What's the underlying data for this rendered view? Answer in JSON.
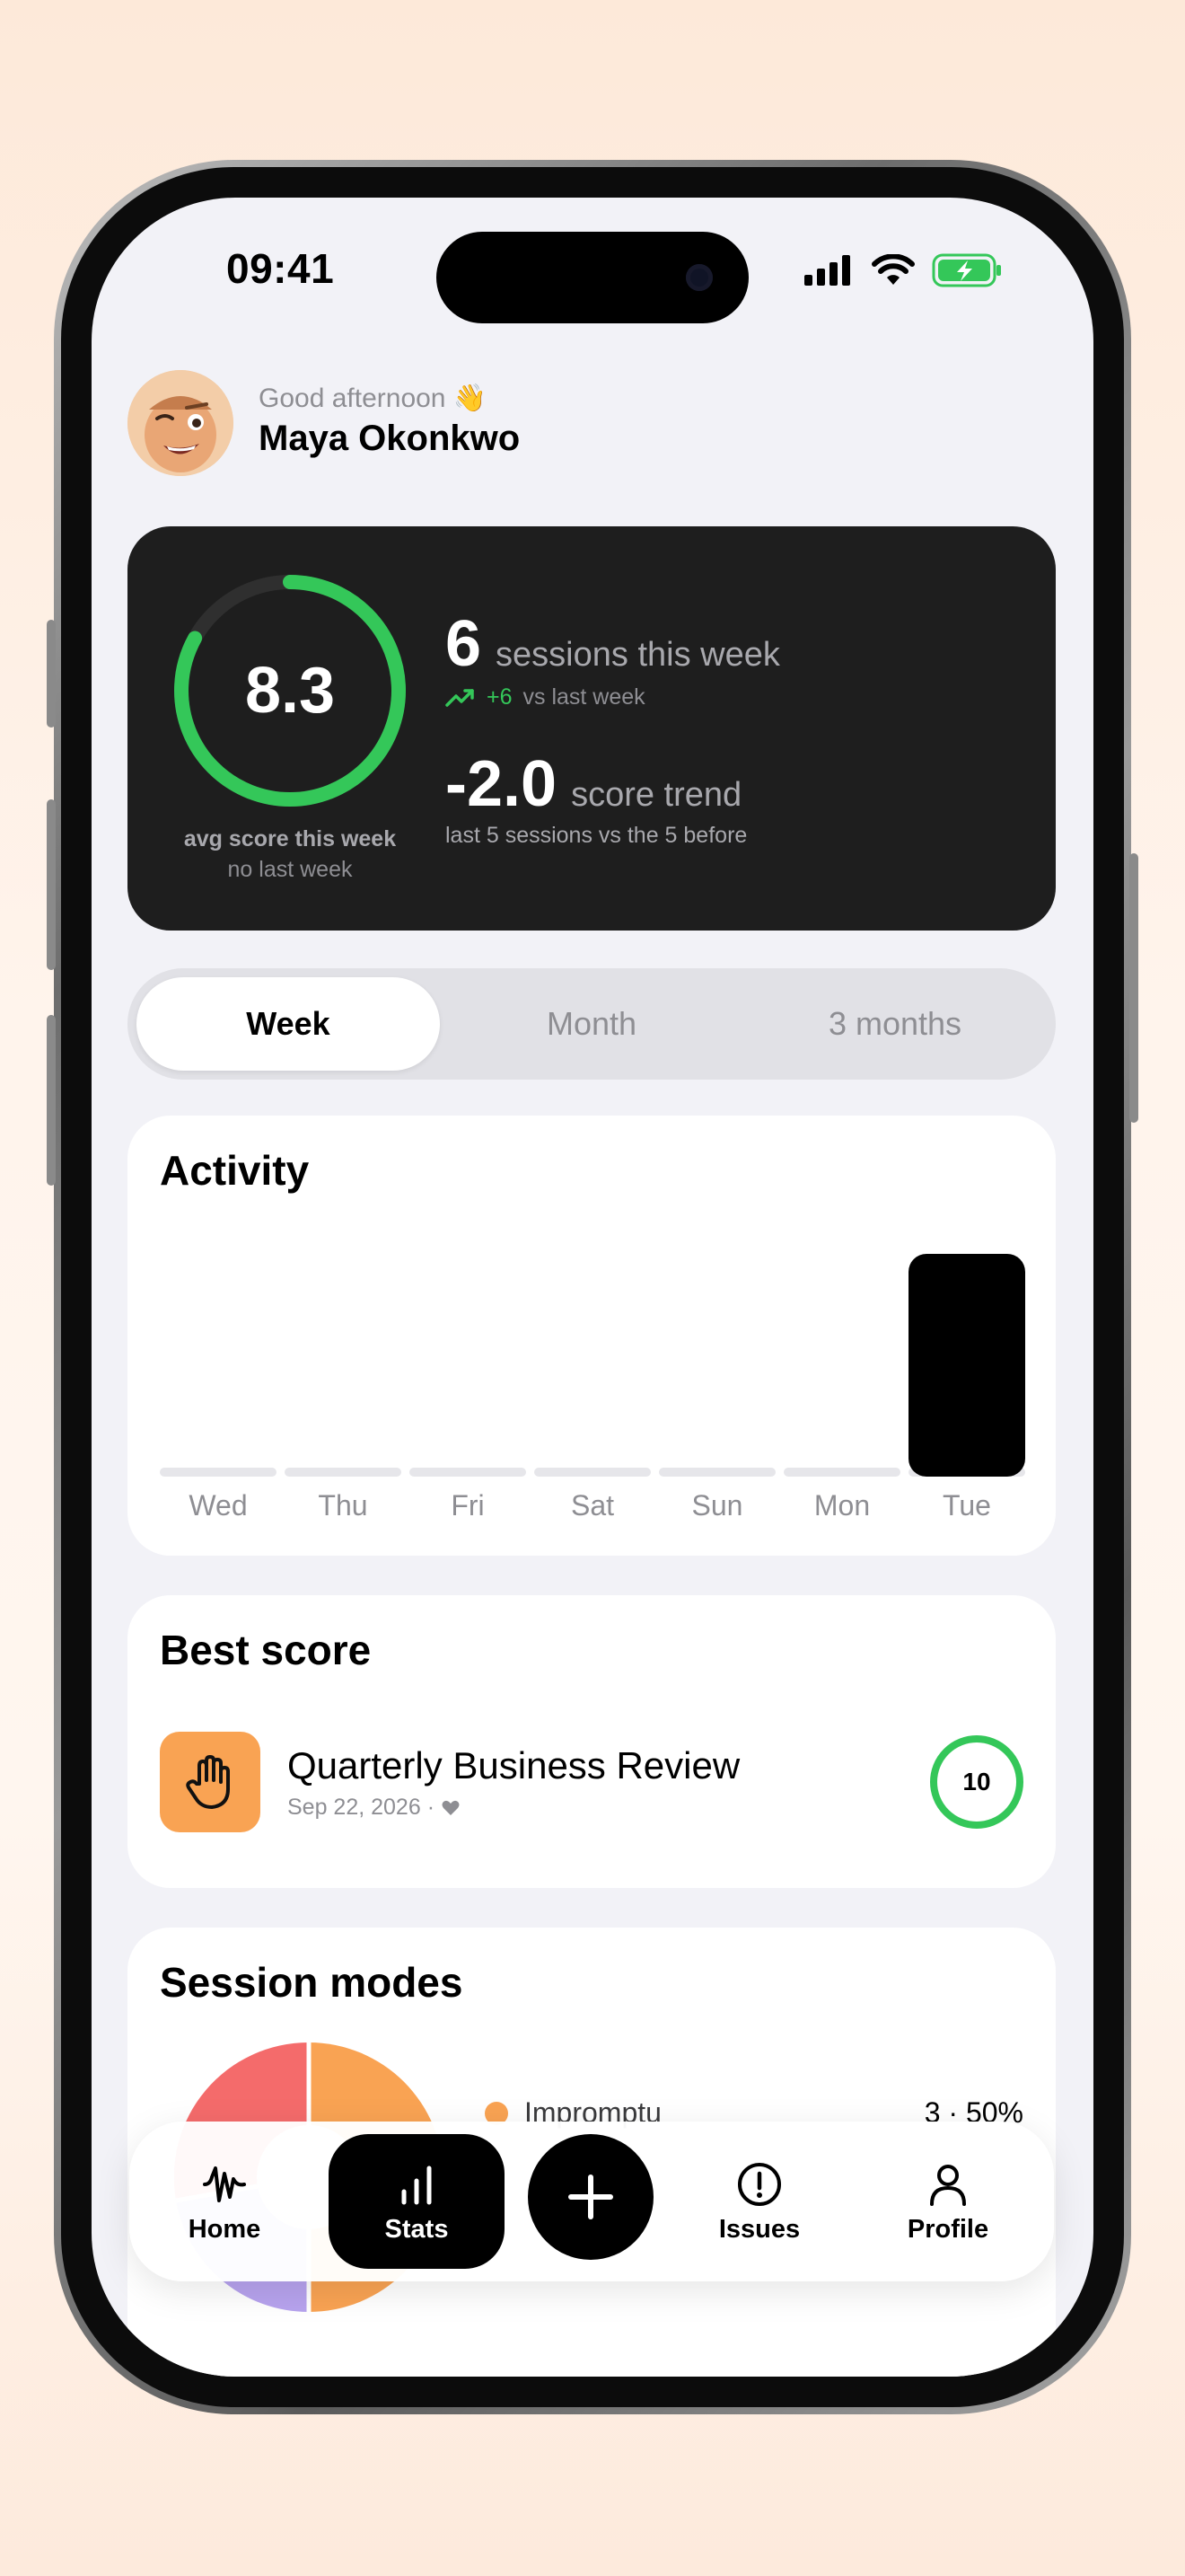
{
  "status_bar": {
    "time": "09:41"
  },
  "header": {
    "greeting": "Good afternoon 👋",
    "name": "Maya Okonkwo"
  },
  "stats": {
    "avg_score": "8.3",
    "avg_score_fraction": 0.83,
    "avg_caption": "avg score this week",
    "avg_sub": "no last week",
    "sessions_value": "6",
    "sessions_label": "sessions this week",
    "sessions_delta": "+6",
    "sessions_delta_label": "vs last week",
    "trend_value": "-2.0",
    "trend_label": "score trend",
    "trend_sub": "last 5 sessions vs the 5 before"
  },
  "range_tabs": [
    {
      "label": "Week",
      "active": true
    },
    {
      "label": "Month",
      "active": false
    },
    {
      "label": "3 months",
      "active": false
    }
  ],
  "activity": {
    "title": "Activity",
    "days": [
      "Wed",
      "Thu",
      "Fri",
      "Sat",
      "Sun",
      "Mon",
      "Tue"
    ],
    "values": [
      0,
      0,
      0,
      0,
      0,
      0,
      6
    ]
  },
  "best_score": {
    "title": "Best score",
    "session_title": "Quarterly Business Review",
    "date": "Sep 22, 2026 ·",
    "score": "10",
    "icon": "hand-icon"
  },
  "session_modes": {
    "title": "Session modes",
    "items": [
      {
        "label": "Impromptu",
        "value": "3 · 50%",
        "color": "#f9a353"
      }
    ],
    "pie_colors": [
      "#f9a353",
      "#b7a3ee",
      "#f46b6b"
    ]
  },
  "tabbar": {
    "items": [
      {
        "label": "Home",
        "icon": "waveform-icon"
      },
      {
        "label": "Stats",
        "icon": "bar-chart-icon",
        "active": true
      },
      {
        "label": "",
        "icon": "plus-icon"
      },
      {
        "label": "Issues",
        "icon": "exclamation-circle-icon"
      },
      {
        "label": "Profile",
        "icon": "person-icon"
      }
    ]
  },
  "colors": {
    "accent_green": "#34c759",
    "card_dark": "#1e1e1e",
    "orange": "#f9a353"
  }
}
